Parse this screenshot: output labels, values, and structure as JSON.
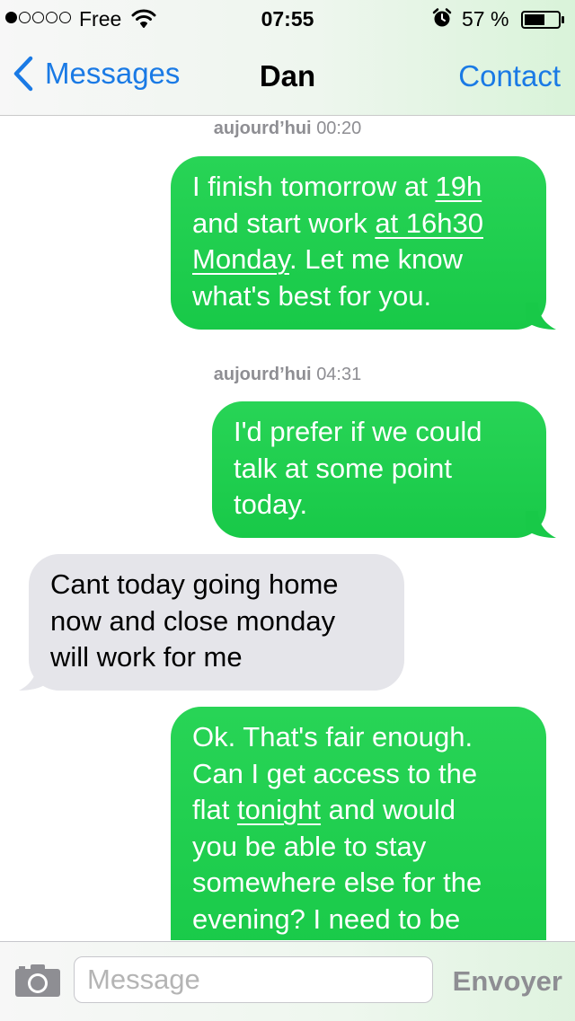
{
  "status_bar": {
    "carrier": "Free",
    "time": "07:55",
    "battery_percent": "57 %",
    "signal_strength": 1,
    "icons": [
      "wifi-icon",
      "alarm-icon",
      "battery-icon"
    ]
  },
  "nav": {
    "back_label": "Messages",
    "title": "Dan",
    "contact_label": "Contact",
    "accent_color": "#1a7ae5"
  },
  "thread": {
    "timestamps": [
      {
        "day": "aujourd’hui",
        "time": "00:20"
      },
      {
        "day": "aujourd’hui",
        "time": "04:31"
      }
    ],
    "messages": [
      {
        "from": "me",
        "parts": [
          "I finish tomorrow at ",
          "19h",
          "and start work ",
          "at 16h30",
          "Monday",
          ".  Let me know",
          "what's best for you."
        ]
      },
      {
        "from": "me",
        "lines": [
          "I'd prefer if we could",
          "talk at some point",
          "today."
        ]
      },
      {
        "from": "Dan",
        "lines": [
          "Cant today going home",
          "now and close monday",
          "will work for me"
        ]
      },
      {
        "from": "me",
        "parts": [
          "Ok.  That's fair enough.",
          "Can I get access to the",
          "flat ",
          "tonight",
          " and would",
          "you be able to stay",
          "somewhere else for the",
          "evening?  I need to be"
        ]
      }
    ],
    "sent_color": "#1fcf4f",
    "received_color": "#e5e5ea"
  },
  "input_bar": {
    "placeholder": "Message",
    "value": "",
    "send_label": "Envoyer"
  }
}
